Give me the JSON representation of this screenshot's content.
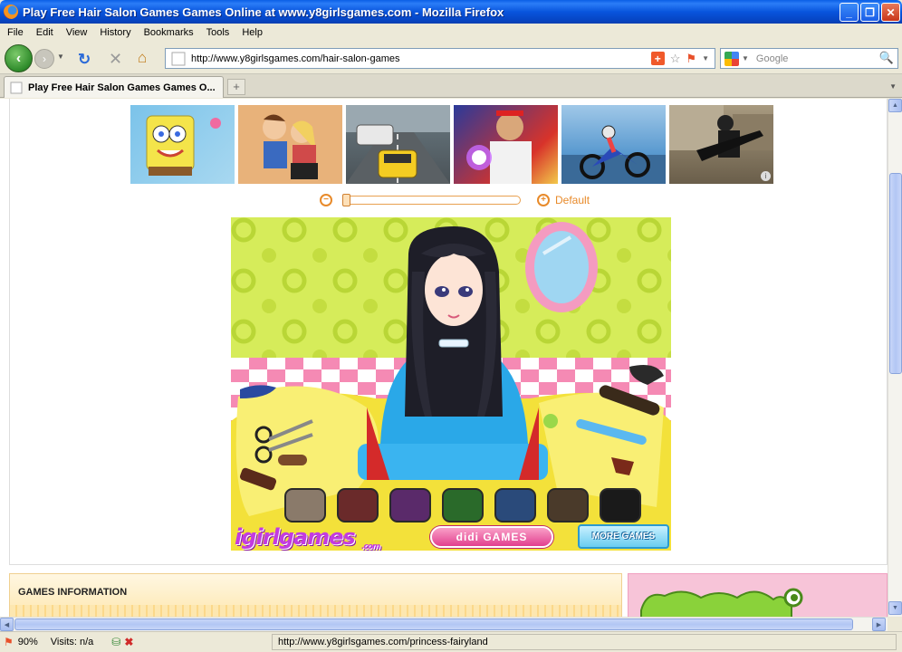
{
  "window": {
    "title": "Play Free Hair Salon Games Games Online at www.y8girlsgames.com - Mozilla Firefox",
    "minimize": "_",
    "maximize": "❐",
    "close": "✕"
  },
  "menu": [
    "File",
    "Edit",
    "View",
    "History",
    "Bookmarks",
    "Tools",
    "Help"
  ],
  "nav": {
    "url": "http://www.y8girlsgames.com/hair-salon-games",
    "search_placeholder": "Google"
  },
  "tabs": [
    {
      "label": "Play Free Hair Salon Games Games O...",
      "active": true
    }
  ],
  "page": {
    "zoom_slider": {
      "label": "Default",
      "level": 0.0
    },
    "game_logos": {
      "igirl": "igirlgames",
      "igirl_com": ".com",
      "didi": "didi GAMES",
      "more": "MORE GAMES"
    },
    "games_info_header": "GAMES INFORMATION"
  },
  "status": {
    "zoom": "90%",
    "visits": "Visits: n/a",
    "url": "http://www.y8girlsgames.com/princess-fairyland"
  },
  "colors": {
    "titlebar": "#0a5fe6",
    "accent_orange": "#e88a2a",
    "game_bg": "#d6ec5a"
  }
}
